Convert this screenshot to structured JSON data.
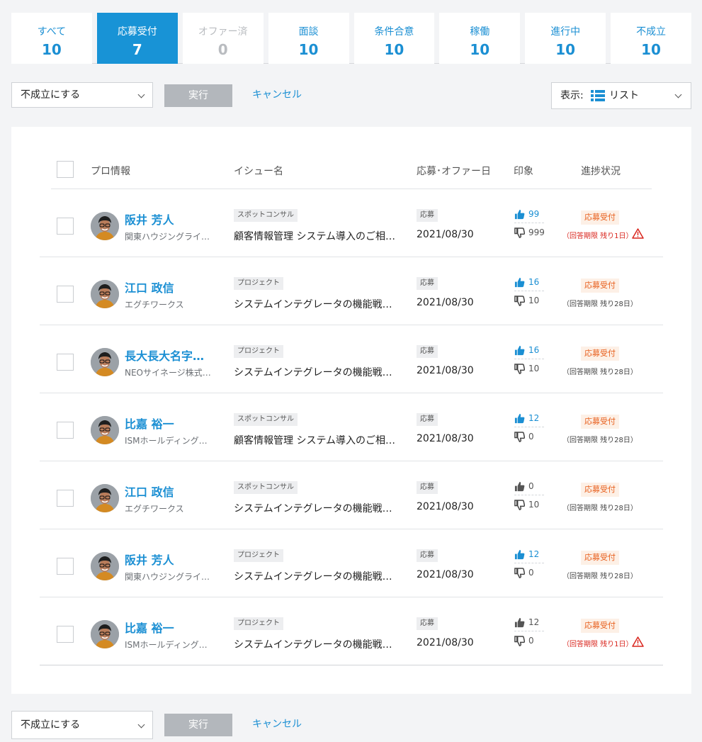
{
  "tabs": [
    {
      "label": "すべて",
      "count": "10"
    },
    {
      "label": "応募受付",
      "count": "7"
    },
    {
      "label": "オファー済",
      "count": "0"
    },
    {
      "label": "面談",
      "count": "10"
    },
    {
      "label": "条件合意",
      "count": "10"
    },
    {
      "label": "稼働",
      "count": "10"
    },
    {
      "label": "進行中",
      "count": "10"
    },
    {
      "label": "不成立",
      "count": "10"
    }
  ],
  "active_tab": 1,
  "actions": {
    "select_value": "不成立にする",
    "execute_label": "実行",
    "cancel_label": "キャンセル",
    "view_label": "表示:",
    "view_value": "リスト"
  },
  "table": {
    "headers": {
      "pro": "プロ情報",
      "issue": "イシュー名",
      "date": "応募･オファー日",
      "impression": "印象",
      "progress": "進捗状況"
    },
    "rows": [
      {
        "name": "阪井 芳人",
        "company": "関東ハウジングライ…",
        "type": "スポットコンサル",
        "issue": "顧客情報管理 システム導入のご相…",
        "appl": "応募",
        "date": "2021/08/30",
        "likes": "99",
        "dislikes": "999",
        "status": "応募受付",
        "deadline": "（回答期限 残り1日）",
        "urgent": true,
        "likes_active": true
      },
      {
        "name": "江口 政信",
        "company": "エグチワークス",
        "type": "プロジェクト",
        "issue": "システムインテグレータの機能戦…",
        "appl": "応募",
        "date": "2021/08/30",
        "likes": "16",
        "dislikes": "10",
        "status": "応募受付",
        "deadline": "（回答期限 残り28日）",
        "urgent": false,
        "likes_active": true
      },
      {
        "name": "長大長大名字…",
        "company": "NEOサイネージ株式…",
        "type": "プロジェクト",
        "issue": "システムインテグレータの機能戦…",
        "appl": "応募",
        "date": "2021/08/30",
        "likes": "16",
        "dislikes": "10",
        "status": "応募受付",
        "deadline": "（回答期限 残り28日）",
        "urgent": false,
        "likes_active": true
      },
      {
        "name": "比嘉 裕一",
        "company": "ISMホールディング…",
        "type": "スポットコンサル",
        "issue": "顧客情報管理 システム導入のご相…",
        "appl": "応募",
        "date": "2021/08/30",
        "likes": "12",
        "dislikes": "0",
        "status": "応募受付",
        "deadline": "（回答期限 残り28日）",
        "urgent": false,
        "likes_active": true
      },
      {
        "name": "江口 政信",
        "company": "エグチワークス",
        "type": "スポットコンサル",
        "issue": "システムインテグレータの機能戦…",
        "appl": "応募",
        "date": "2021/08/30",
        "likes": "0",
        "dislikes": "10",
        "status": "応募受付",
        "deadline": "（回答期限 残り28日）",
        "urgent": false,
        "likes_active": false
      },
      {
        "name": "阪井 芳人",
        "company": "関東ハウジングライ…",
        "type": "プロジェクト",
        "issue": "システムインテグレータの機能戦…",
        "appl": "応募",
        "date": "2021/08/30",
        "likes": "12",
        "dislikes": "0",
        "status": "応募受付",
        "deadline": "（回答期限 残り28日）",
        "urgent": false,
        "likes_active": true
      },
      {
        "name": "比嘉 裕一",
        "company": "ISMホールディング…",
        "type": "プロジェクト",
        "issue": "システムインテグレータの機能戦…",
        "appl": "応募",
        "date": "2021/08/30",
        "likes": "12",
        "dislikes": "0",
        "status": "応募受付",
        "deadline": "（回答期限 残り1日）",
        "urgent": true,
        "likes_active": false
      }
    ]
  },
  "colors": {
    "accent": "#1893d6",
    "status_orange": "#e8601e",
    "urgent_red": "#d9251d"
  },
  "icons": {
    "list": "list-icon",
    "like": "thumbs-up-icon",
    "dislike": "thumbs-down-icon",
    "warning": "warning-triangle-icon",
    "dropdown": "chevron-down-icon"
  }
}
